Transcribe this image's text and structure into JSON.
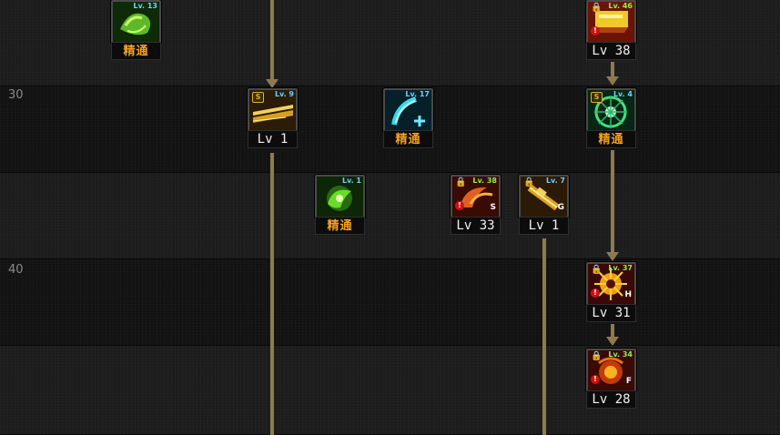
{
  "rows": [
    {
      "label": ""
    },
    {
      "label": "30"
    },
    {
      "label": ""
    },
    {
      "label": "40"
    },
    {
      "label": ""
    }
  ],
  "skills": {
    "s1": {
      "badge": "Lv. 13",
      "caption": "精通",
      "color": "#7cd630"
    },
    "s2": {
      "badge": "Lv. 46",
      "caption": "Lv 38",
      "color": "#e0c020"
    },
    "s3": {
      "badge": "Lv. 9",
      "caption": "Lv 1",
      "color": "#d6a020",
      "mark": "S"
    },
    "s4": {
      "badge": "Lv. 17",
      "caption": "精通",
      "color": "#30d0e0"
    },
    "s5": {
      "badge": "Lv. 4",
      "caption": "精通",
      "color": "#40e080",
      "mark": "S"
    },
    "s6": {
      "badge": "Lv. 1",
      "caption": "精通",
      "color": "#6adc28"
    },
    "s7": {
      "badge": "Lv. 38",
      "caption": "Lv 33",
      "color": "#e06020",
      "type": "S"
    },
    "s8": {
      "badge": "Lv. 7",
      "caption": "Lv 1",
      "color": "#e0a020",
      "type": "G"
    },
    "s9": {
      "badge": "Lv. 37",
      "caption": "Lv 31",
      "color": "#f0a010",
      "type": "H"
    },
    "s10": {
      "badge": "Lv. 34",
      "caption": "Lv 28",
      "color": "#f07010",
      "type": "F"
    }
  },
  "icons": {
    "lock": "🔒",
    "warning": "!"
  },
  "colors": {
    "connector": "#8f7a50",
    "master_text": "#f2a020"
  }
}
